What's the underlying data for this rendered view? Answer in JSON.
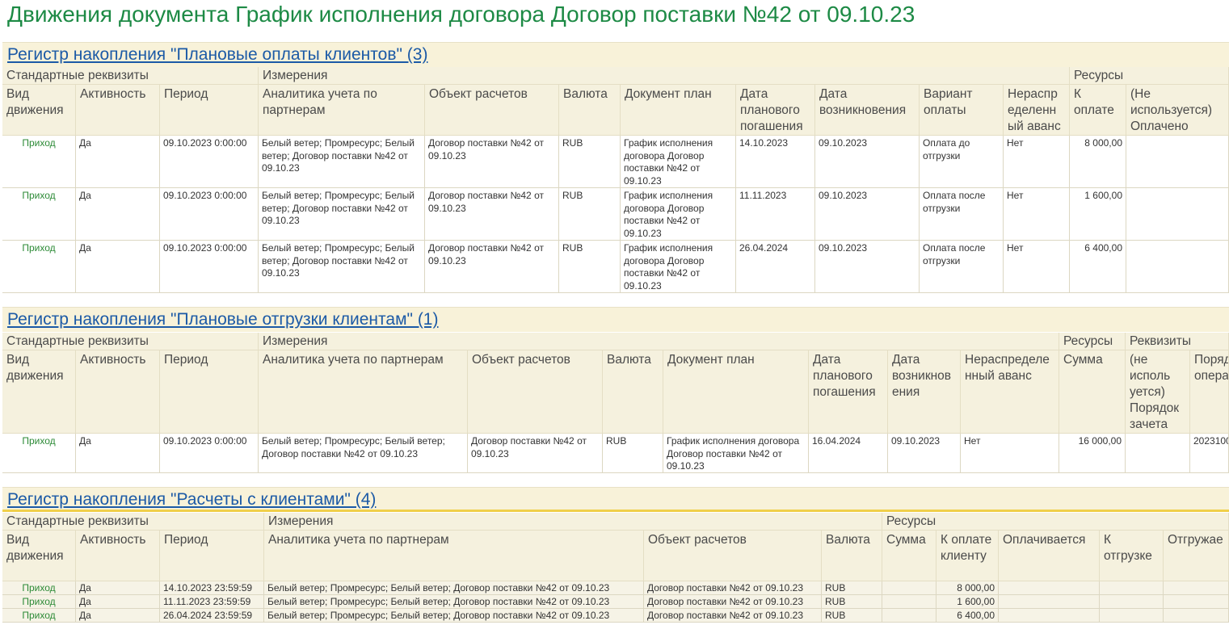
{
  "page_title": "Движения документа График исполнения договора Договор поставки №42 от 09.10.23",
  "sections": [
    {
      "title": "Регистр накопления \"Плановые оплаты клиентов\" (3)",
      "groups": [
        "Стандартные реквизиты",
        "Измерения",
        "Ресурсы"
      ],
      "columns": [
        "Вид движения",
        "Активность",
        "Период",
        "Аналитика учета по партнерам",
        "Объект расчетов",
        "Валюта",
        "Документ план",
        "Дата планового погашения",
        "Дата возникновения",
        "Вариант оплаты",
        "Нераспр еделенн ый аванс",
        "К оплате",
        "(Не используется) Оплачено"
      ],
      "rows": [
        [
          "Приход",
          "Да",
          "09.10.2023 0:00:00",
          "Белый ветер; Промресурс; Белый ветер; Договор поставки №42 от 09.10.23",
          "Договор поставки №42 от 09.10.23",
          "RUB",
          "График исполнения договора Договор поставки №42 от 09.10.23",
          "14.10.2023",
          "09.10.2023",
          "Оплата до отгрузки",
          "Нет",
          "8 000,00",
          ""
        ],
        [
          "Приход",
          "Да",
          "09.10.2023 0:00:00",
          "Белый ветер; Промресурс; Белый ветер; Договор поставки №42 от 09.10.23",
          "Договор поставки №42 от 09.10.23",
          "RUB",
          "График исполнения договора Договор поставки №42 от 09.10.23",
          "11.11.2023",
          "09.10.2023",
          "Оплата после отгрузки",
          "Нет",
          "1 600,00",
          ""
        ],
        [
          "Приход",
          "Да",
          "09.10.2023 0:00:00",
          "Белый ветер; Промресурс; Белый ветер; Договор поставки №42 от 09.10.23",
          "Договор поставки №42 от 09.10.23",
          "RUB",
          "График исполнения договора Договор поставки №42 от 09.10.23",
          "26.04.2024",
          "09.10.2023",
          "Оплата после отгрузки",
          "Нет",
          "6 400,00",
          ""
        ]
      ]
    },
    {
      "title": "Регистр накопления \"Плановые отгрузки клиентам\" (1)",
      "groups": [
        "Стандартные реквизиты",
        "Измерения",
        "Ресурсы",
        "Реквизиты"
      ],
      "columns": [
        "Вид движения",
        "Активность",
        "Период",
        "Аналитика учета по партнерам",
        "Объект расчетов",
        "Валюта",
        "Документ план",
        "Дата планового погашения",
        "Дата возникнов ения",
        "Нераспределе нный аванс",
        "Сумма",
        "(не исполь уется) Порядок зачета",
        "Поряд опера"
      ],
      "rows": [
        [
          "Приход",
          "Да",
          "09.10.2023 0:00:00",
          "Белый ветер; Промресурс; Белый ветер; Договор поставки №42 от 09.10.23",
          "Договор поставки №42 от 09.10.23",
          "RUB",
          "График исполнения договора Договор поставки №42 от 09.10.23",
          "16.04.2024",
          "09.10.2023",
          "Нет",
          "16 000,00",
          "",
          "2023100"
        ]
      ]
    },
    {
      "title": "Регистр накопления \"Расчеты с клиентами\" (4)",
      "groups": [
        "Стандартные реквизиты",
        "Измерения",
        "Ресурсы"
      ],
      "columns": [
        "Вид движения",
        "Активность",
        "Период",
        "Аналитика учета по партнерам",
        "Объект расчетов",
        "Валюта",
        "Сумма",
        "К оплате клиенту",
        "Оплачивается",
        "К отгрузке",
        "Отгружае"
      ],
      "rows": [
        [
          "Приход",
          "Да",
          "14.10.2023 23:59:59",
          "Белый ветер; Промресурс; Белый ветер; Договор поставки №42 от 09.10.23",
          "Договор поставки №42 от 09.10.23",
          "RUB",
          "",
          "8 000,00",
          "",
          "",
          ""
        ],
        [
          "Приход",
          "Да",
          "11.11.2023 23:59:59",
          "Белый ветер; Промресурс; Белый ветер; Договор поставки №42 от 09.10.23",
          "Договор поставки №42 от 09.10.23",
          "RUB",
          "",
          "1 600,00",
          "",
          "",
          ""
        ],
        [
          "Приход",
          "Да",
          "26.04.2024 23:59:59",
          "Белый ветер; Промресурс; Белый ветер; Договор поставки №42 от 09.10.23",
          "Договор поставки №42 от 09.10.23",
          "RUB",
          "",
          "6 400,00",
          "",
          "",
          ""
        ]
      ]
    }
  ]
}
